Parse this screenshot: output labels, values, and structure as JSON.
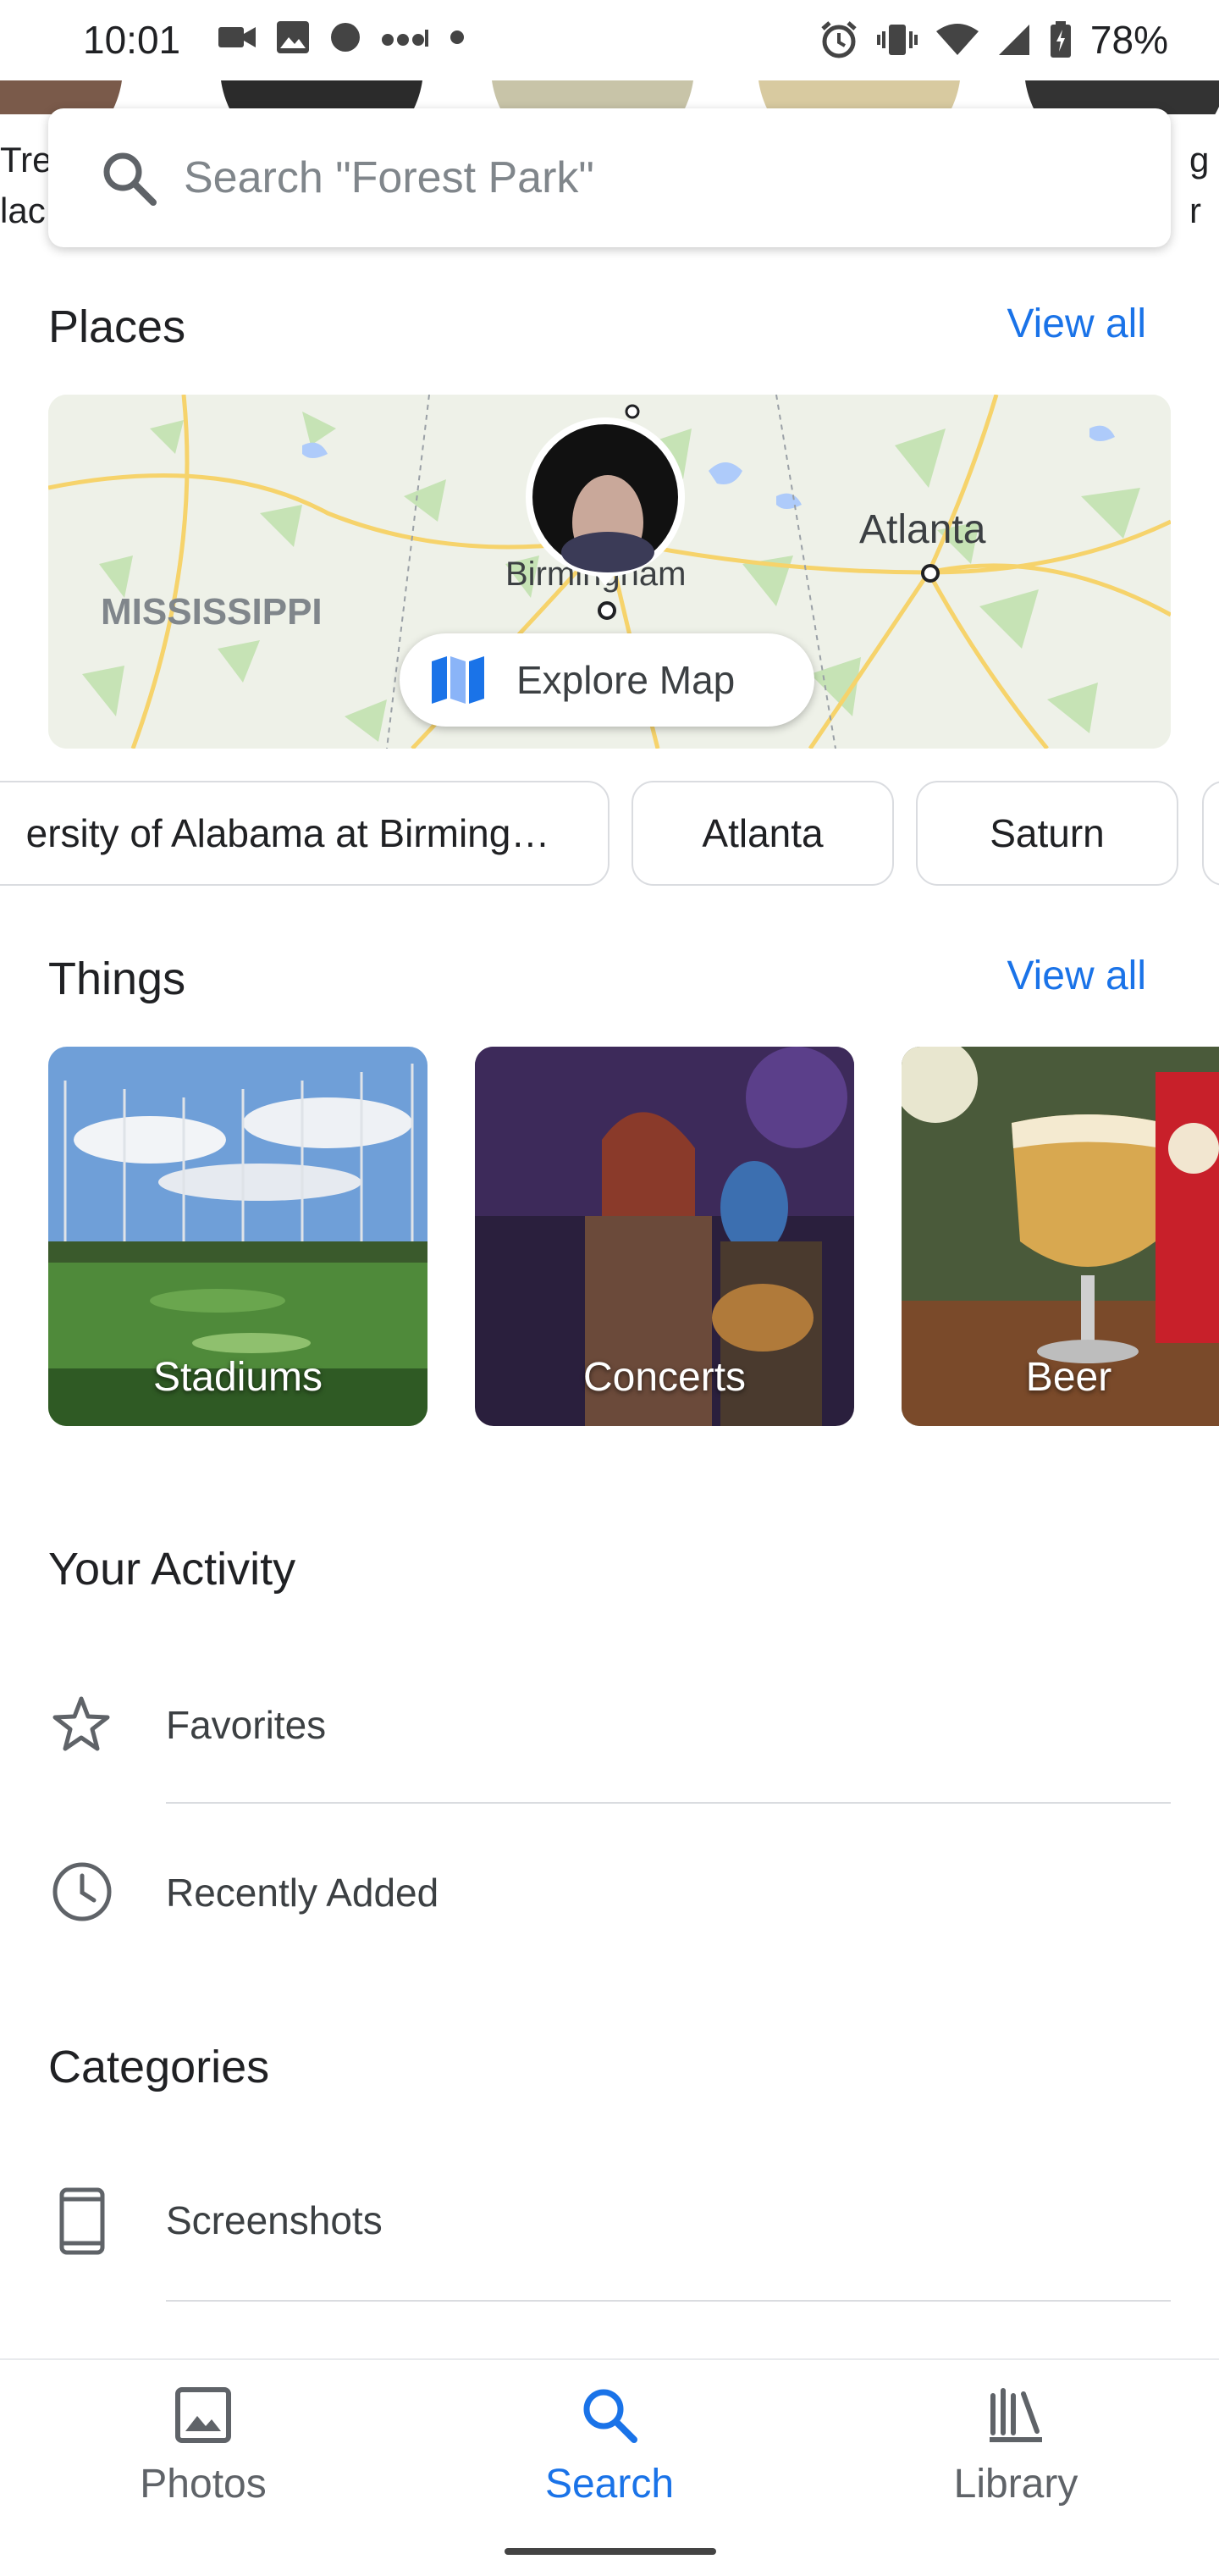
{
  "status_bar": {
    "time": "10:01",
    "battery": "78%"
  },
  "faces": {
    "caption_left": [
      "Tre",
      "lac"
    ],
    "caption_right": [
      "g",
      "r"
    ]
  },
  "search": {
    "placeholder": "Search \"Forest Park\""
  },
  "places": {
    "title": "Places",
    "view_all": "View all",
    "map_labels": {
      "state": "MISSISSIPPI",
      "city1": "Birmingham",
      "city2": "Atlanta"
    },
    "explore_label": "Explore Map",
    "chips": [
      "ersity of Alabama at Birming…",
      "Atlanta",
      "Saturn"
    ]
  },
  "things": {
    "title": "Things",
    "view_all": "View all",
    "items": [
      {
        "label": "Stadiums"
      },
      {
        "label": "Concerts"
      },
      {
        "label": "Beer"
      }
    ]
  },
  "activity": {
    "title": "Your Activity",
    "items": [
      {
        "label": "Favorites",
        "icon": "star-icon"
      },
      {
        "label": "Recently Added",
        "icon": "clock-icon"
      }
    ]
  },
  "categories": {
    "title": "Categories",
    "items": [
      {
        "label": "Screenshots",
        "icon": "phone-icon"
      }
    ]
  },
  "bottom_nav": {
    "items": [
      {
        "label": "Photos",
        "icon": "photo-icon",
        "active": false
      },
      {
        "label": "Search",
        "icon": "search-icon",
        "active": true
      },
      {
        "label": "Library",
        "icon": "library-icon",
        "active": false
      }
    ],
    "active_color": "#1a73e8",
    "inactive_color": "#5f6368"
  }
}
